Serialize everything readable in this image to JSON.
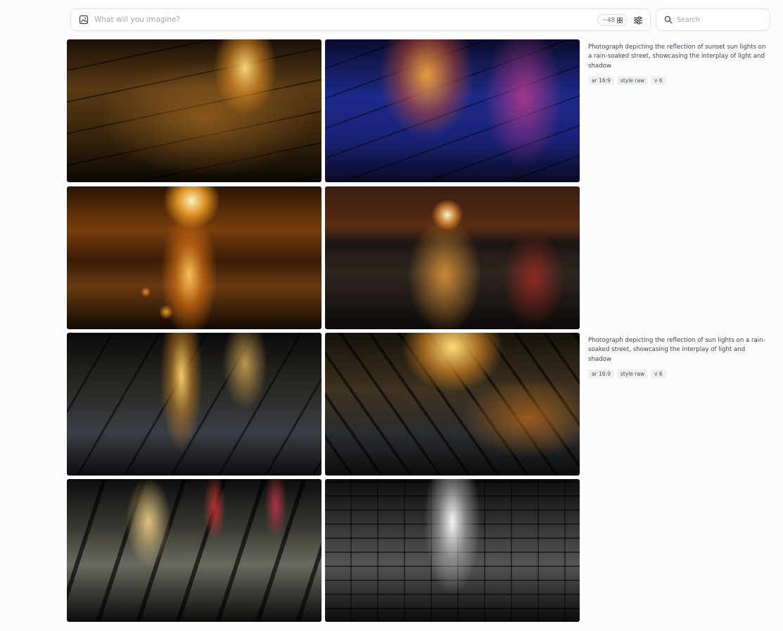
{
  "prompt_bar": {
    "placeholder": "What will you imagine?",
    "count": "~48"
  },
  "search": {
    "placeholder": "Search"
  },
  "jobs": [
    {
      "prompt": "Photograph depicting the reflection of sunset sun lights on a rain-soaked street, showcasing the interplay of light and shadow",
      "tags": [
        "ar 16:9",
        "style raw",
        "v 6"
      ]
    },
    {
      "prompt": "Photograph depicting the reflection of sun lights on a rain-soaked street, showcasing the interplay of light and shadow",
      "tags": [
        "ar 16:9",
        "style raw",
        "v 6"
      ]
    }
  ]
}
